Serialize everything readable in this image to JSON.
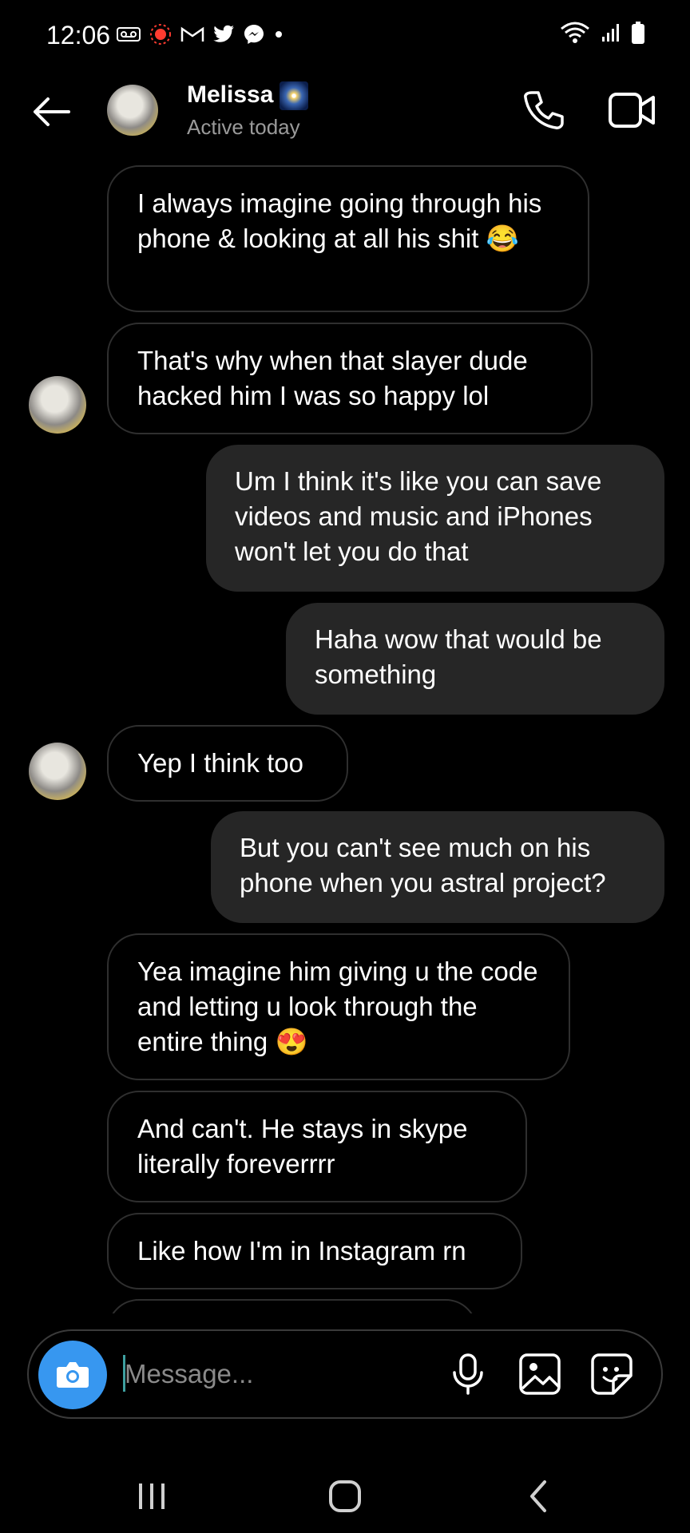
{
  "status_bar": {
    "time": "12:06",
    "left_icons": [
      "voicemail-icon",
      "recording-icon",
      "gmail-icon",
      "twitter-icon",
      "messenger-icon",
      "dot-icon"
    ],
    "right_icons": [
      "wifi-icon",
      "signal-icon",
      "battery-icon"
    ]
  },
  "header": {
    "contact_name": "Melissa",
    "contact_status": "Active today",
    "icons": [
      "back-arrow-icon",
      "phone-icon",
      "video-camera-icon"
    ]
  },
  "messages": [
    {
      "direction": "incoming",
      "text": "I always imagine going through his phone & looking at all his shit 😂"
    },
    {
      "direction": "incoming",
      "text": "That's why when that slayer dude hacked him I was so happy lol",
      "show_avatar": true
    },
    {
      "direction": "outgoing",
      "text": "Um I think it's like you can save videos and music and iPhones won't let you do that"
    },
    {
      "direction": "outgoing",
      "text": "Haha wow that would be something"
    },
    {
      "direction": "incoming",
      "text": "Yep I think too",
      "show_avatar": true
    },
    {
      "direction": "outgoing",
      "text": "But you can't see much on his phone when you astral project?"
    },
    {
      "direction": "incoming",
      "text": "Yea imagine him giving u the code and letting u look through the entire thing 😍"
    },
    {
      "direction": "incoming",
      "text": "And can't. He stays in skype literally foreverrrr"
    },
    {
      "direction": "incoming",
      "text": "Like how I'm in Instagram rn"
    }
  ],
  "composer": {
    "placeholder": "Message...",
    "icons": [
      "camera-icon",
      "microphone-icon",
      "gallery-icon",
      "sticker-icon"
    ]
  },
  "colors": {
    "background": "#000000",
    "outgoing_bubble": "#262626",
    "incoming_border": "#2f2f2f",
    "accent_blue": "#3797f0",
    "muted_text": "#9a9a9a"
  },
  "nav_bar": {
    "icons": [
      "recents-icon",
      "home-icon",
      "back-icon"
    ]
  }
}
